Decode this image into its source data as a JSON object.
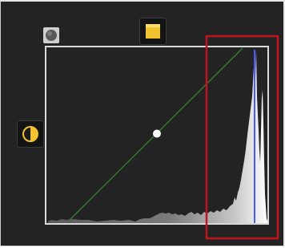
{
  "curves_panel": {
    "icons": {
      "black_point": "black-point-eyedropper-icon",
      "white_point": "white-point-eyedropper-icon",
      "midtone": "midtone-contrast-icon"
    },
    "control_point": {
      "input": 0.5,
      "output": 0.5
    },
    "highlight_box": {
      "color": "#c0141e"
    },
    "colors": {
      "background": "#232323",
      "grid_border": "#d8d8d8",
      "diagonal": "#2f7a2f",
      "marker_line": "#4a5cff",
      "white_point_icon": "#f2c230",
      "highlight": "#c0141e"
    }
  }
}
